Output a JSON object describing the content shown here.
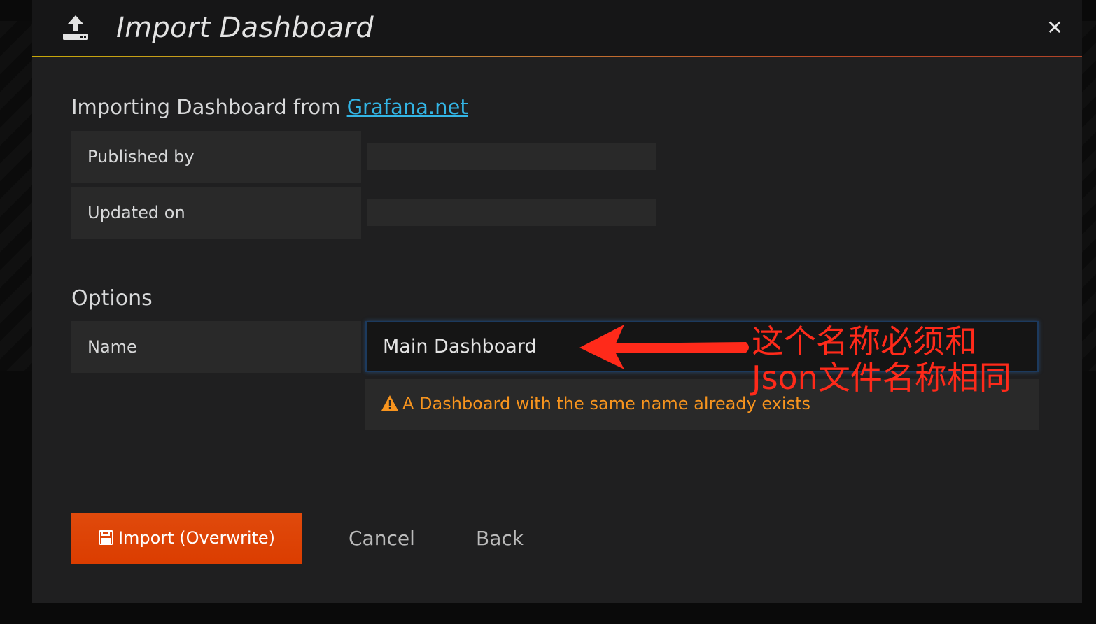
{
  "dialog": {
    "title": "Import Dashboard",
    "close_icon": "close-icon",
    "upload_icon": "upload-icon"
  },
  "source": {
    "prefix": "Importing Dashboard from ",
    "link_text": "Grafana.net"
  },
  "meta_fields": [
    {
      "label": "Published by",
      "value": ""
    },
    {
      "label": "Updated on",
      "value": ""
    }
  ],
  "options": {
    "heading": "Options",
    "name_label": "Name",
    "name_value": "Main Dashboard",
    "warning_icon": "warning-triangle-icon",
    "warning_text": "A Dashboard with the same name already exists"
  },
  "actions": {
    "import_label": "Import (Overwrite)",
    "import_icon": "save-icon",
    "cancel_label": "Cancel",
    "back_label": "Back"
  },
  "annotation": {
    "line1": "这个名称必须和",
    "line2": "Json文件名称相同"
  },
  "colors": {
    "accent_link": "#33b5e5",
    "warning": "#f7941e",
    "primary_button": "#e3460e",
    "annotation": "#ff2a1a"
  }
}
